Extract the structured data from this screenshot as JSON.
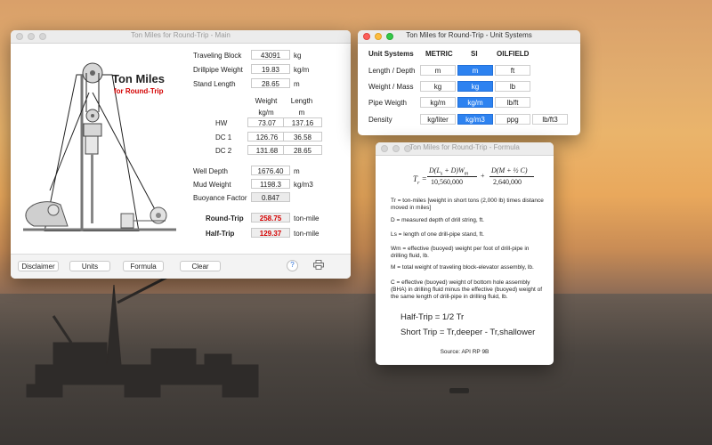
{
  "main_window": {
    "title": "Ton Miles for Round-Trip - Main",
    "heading": "Ton Miles",
    "subheading": "for Round-Trip",
    "inputs": [
      {
        "label": "Traveling Block",
        "value": "43091",
        "unit": "kg"
      },
      {
        "label": "Drillpipe Weight",
        "value": "19.83",
        "unit": "kg/m"
      },
      {
        "label": "Stand Length",
        "value": "28.65",
        "unit": "m"
      }
    ],
    "table": {
      "col1_header": "Weight",
      "col1_unit": "kg/m",
      "col2_header": "Length",
      "col2_unit": "m",
      "rows": [
        {
          "label": "HW",
          "weight": "73.07",
          "length": "137.16"
        },
        {
          "label": "DC 1",
          "weight": "126.76",
          "length": "36.58"
        },
        {
          "label": "DC 2",
          "weight": "131.68",
          "length": "28.65"
        }
      ]
    },
    "well_depth": {
      "label": "Well Depth",
      "value": "1676.40",
      "unit": "m"
    },
    "mud_weight": {
      "label": "Mud Weight",
      "value": "1198.3",
      "unit": "kg/m3"
    },
    "buoyance": {
      "label": "Buoyance Factor",
      "value": "0.847"
    },
    "round_trip": {
      "label": "Round-Trip",
      "value": "258.75",
      "unit": "ton-mile"
    },
    "half_trip": {
      "label": "Half-Trip",
      "value": "129.37",
      "unit": "ton-mile"
    },
    "buttons": {
      "disclaimer": "Disclaimer",
      "units": "Units",
      "formula": "Formula",
      "clear": "Clear",
      "help": "?"
    },
    "icons": {
      "help": "help-icon",
      "print": "printer-icon"
    }
  },
  "units_window": {
    "title": "Ton Miles for Round-Trip - Unit Systems",
    "headers": [
      "Unit Systems",
      "METRIC",
      "SI",
      "OILFIELD"
    ],
    "rows": [
      {
        "label": "Length / Depth",
        "options": [
          "m",
          "m",
          "ft"
        ],
        "selected": 1
      },
      {
        "label": "Weight / Mass",
        "options": [
          "kg",
          "kg",
          "lb"
        ],
        "selected": 1
      },
      {
        "label": "Pipe Weigth",
        "options": [
          "kg/m",
          "kg/m",
          "lb/ft"
        ],
        "selected": 1
      },
      {
        "label": "Density",
        "options": [
          "kg/liter",
          "kg/m3",
          "ppg",
          "lb/ft3"
        ],
        "selected": 1
      }
    ],
    "accent_color": "#2d82f0"
  },
  "formula_window": {
    "title": "Ton Miles for Round-Trip - Formula",
    "equation": {
      "lhs": "T",
      "lhs_sub": "r",
      "num1": "D(L",
      "num1_sub": "s",
      "num1_rest": " + D)W",
      "num1_sub2": "m",
      "den1": "10,560,000",
      "plus": "+",
      "num2": "D(M + ½ C)",
      "den2": "2,640,000"
    },
    "definitions": [
      "Tr = ton-miles [weight in short tons (2,000 lb) times distance moved in miles]",
      "D = measured depth of drill string, ft.",
      "Ls = length of one drill-pipe stand, ft.",
      "Wm = effective (buoyed) weight per foot of drill-pipe in drilling fluid, lb.",
      "M = total weight of traveling block-elevator assembly, lb.",
      "C = effective (buoyed) weight of bottom hole assembly (BHA) in drilling fluid minus the effective (buoyed) weight of the same length of drill-pipe in drilling fluid, lb."
    ],
    "half_trip": "Half-Trip = 1/2 Tr",
    "short_trip": "Short Trip = Tr,deeper - Tr,shallower",
    "source": "Source: API RP 9B"
  }
}
